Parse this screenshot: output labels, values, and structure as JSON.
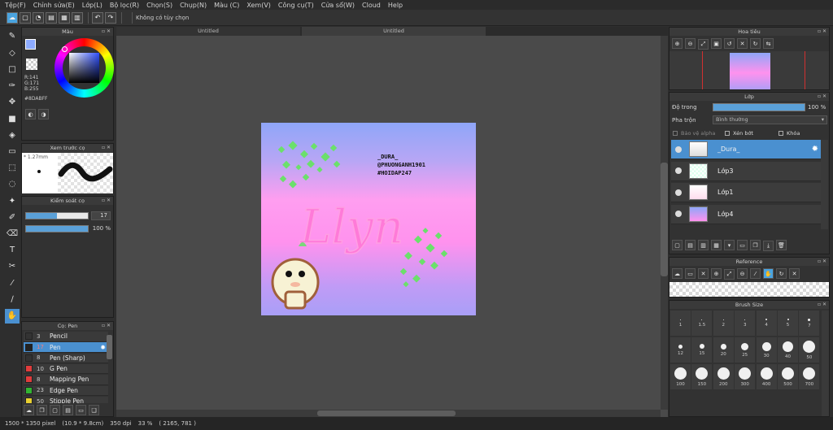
{
  "menu": [
    "Tệp(F)",
    "Chỉnh sửa(E)",
    "Lớp(L)",
    "Bộ lọc(R)",
    "Chọn(S)",
    "Chụp(N)",
    "Màu (C)",
    "Xem(V)",
    "Công cụ(T)",
    "Cửa sổ(W)",
    "Cloud",
    "Help"
  ],
  "toolbar": {
    "option_text": "Không có tùy chọn"
  },
  "panels": {
    "color": "Màu",
    "brush_preview": "Xem trước cọ",
    "brush_control": "Kiểm soát cọ",
    "brush_list": "Cọ: Pen",
    "navigator": "Hoa tiêu",
    "layer": "Lớp",
    "reference": "Reference",
    "brush_size": "Brush Size"
  },
  "color": {
    "r": "R:141",
    "g": "G:171",
    "b": "B:255",
    "hex": "#8DABFF",
    "swatch": "#8DABFF"
  },
  "brush_preview": {
    "size_label": "* 1.27mm"
  },
  "brush_control": {
    "size_value": "17",
    "opacity_value": "100 %",
    "size_fraction": 0.5,
    "opacity_fraction": 1.0
  },
  "brushes": [
    {
      "num": "3",
      "name": "Pencil",
      "color": "#333333"
    },
    {
      "num": "17",
      "name": "Pen",
      "color": "#222222",
      "selected": true
    },
    {
      "num": "8",
      "name": "Pen (Sharp)",
      "color": "#333333"
    },
    {
      "num": "10",
      "name": "G Pen",
      "color": "#e03c3c"
    },
    {
      "num": "8",
      "name": "Mapping Pen",
      "color": "#e03c3c"
    },
    {
      "num": "23",
      "name": "Edge Pen",
      "color": "#32b432"
    },
    {
      "num": "50",
      "name": "Stipple Pen",
      "color": "#e8d030"
    }
  ],
  "tabs": [
    "Untitled",
    "Untitled"
  ],
  "artwork": {
    "title_text": "Llyn",
    "credit_line1": "_DURA_",
    "credit_line2": "@PHUONGANH1901",
    "credit_line3": "#HOIDAP247"
  },
  "layer": {
    "opacity_label": "Độ trong",
    "opacity_value": "100 %",
    "blend_label": "Pha trộn",
    "blend_value": "Bình thường",
    "protect_alpha": "Bảo vệ alpha",
    "clipping": "Xén bớt",
    "lock": "Khóa",
    "layers": [
      {
        "name": "_Dura_",
        "selected": true
      },
      {
        "name": "Lớp3"
      },
      {
        "name": "Lớp1"
      },
      {
        "name": "Lớp4"
      }
    ]
  },
  "brush_sizes": [
    "1",
    "1.5",
    "2",
    "3",
    "4",
    "5",
    "7",
    "12",
    "15",
    "20",
    "25",
    "30",
    "40",
    "50",
    "100",
    "150",
    "200",
    "300",
    "400",
    "500",
    "700"
  ],
  "status": {
    "dims": "1500 * 1350 pixel",
    "physical": "(10.9 * 9.8cm)",
    "dpi": "350 dpi",
    "zoom": "33 %",
    "coords": "( 2165, 781 )"
  }
}
